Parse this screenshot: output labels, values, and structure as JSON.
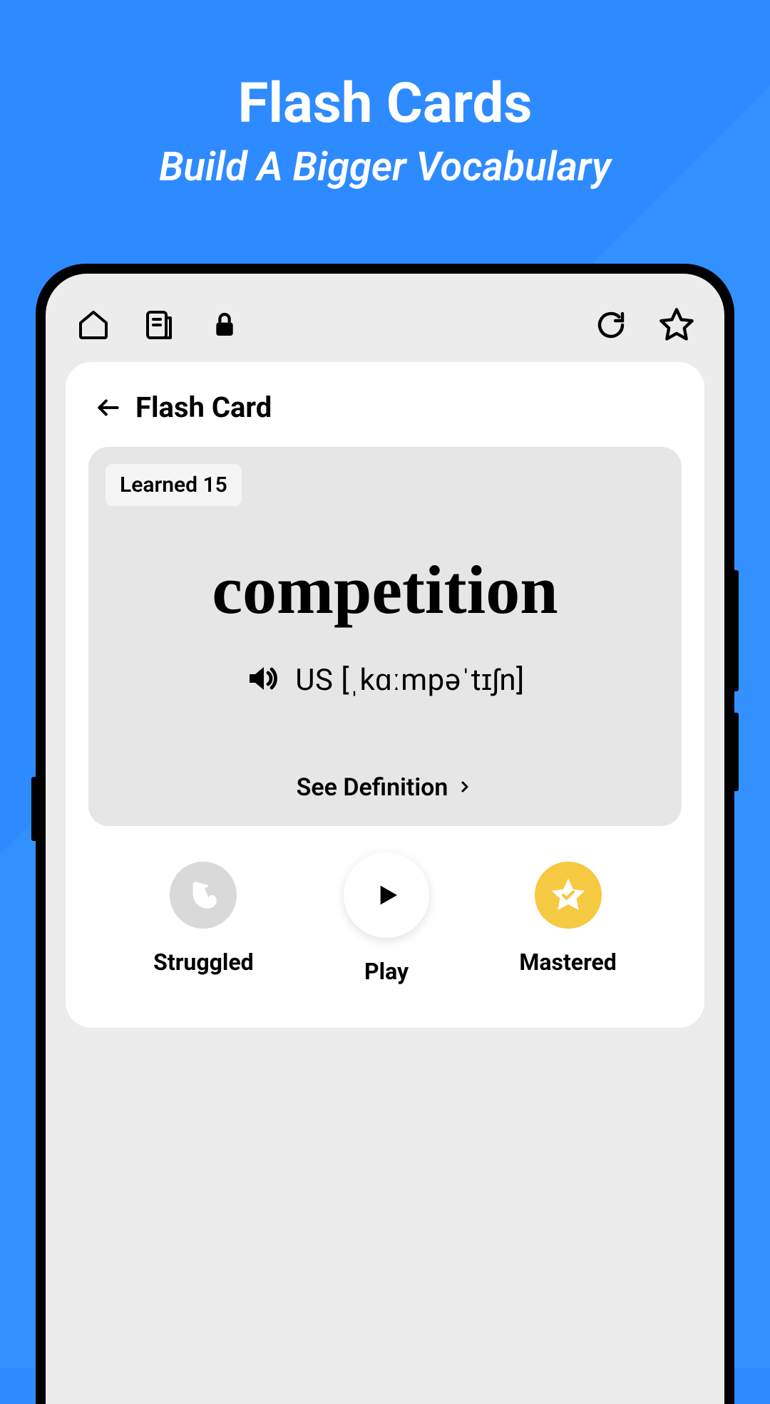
{
  "promo": {
    "title": "Flash Cards",
    "subtitle": "Build A Bigger Vocabulary"
  },
  "page": {
    "title": "Flash Card"
  },
  "card": {
    "learned_badge": "Learned 15",
    "word": "competition",
    "pronunciation": "US [ˌkɑːmpəˈtɪʃn]",
    "see_definition": "See Definition"
  },
  "actions": {
    "struggled": "Struggled",
    "play": "Play",
    "mastered": "Mastered"
  }
}
